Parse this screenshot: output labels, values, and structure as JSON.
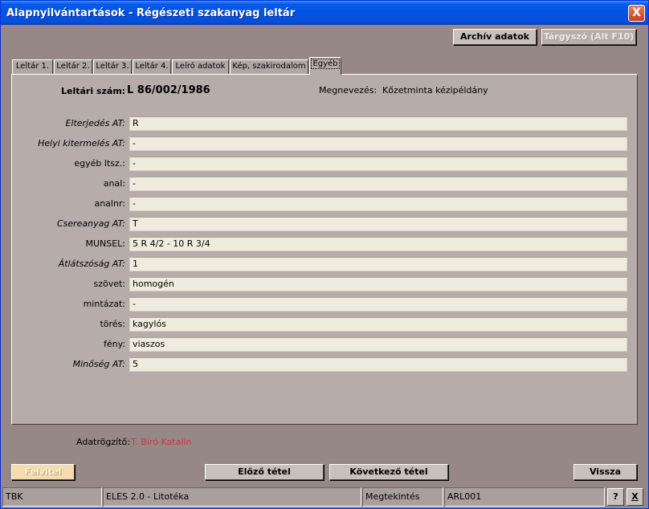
{
  "window": {
    "title": "Alapnyilvántartások - Régészeti szakanyag leltár",
    "close_label": "X"
  },
  "toolbar": {
    "archive_label": "Archív adatok",
    "subject_label": "Tárgyszó (Alt F10)"
  },
  "tabs": [
    {
      "label": "Leltár 1."
    },
    {
      "label": "Leltár 2."
    },
    {
      "label": "Leltár 3."
    },
    {
      "label": "Leltár 4."
    },
    {
      "label": "Leíró adatok"
    },
    {
      "label": "Kép, szakirodalom"
    },
    {
      "label": "Egyéb",
      "active": true
    }
  ],
  "header": {
    "inv_label": "Leltári szám:",
    "inv_value": "L 86/002/1986",
    "name_label": "Megnevezés:",
    "name_value": "Kőzetminta kézipéldány"
  },
  "fields": [
    {
      "label": "Elterjedés AT:",
      "value": "R"
    },
    {
      "label": "Helyi kitermelés AT:",
      "value": "-"
    },
    {
      "label": "egyéb ltsz.:",
      "value": "-"
    },
    {
      "label": "anal:",
      "value": "-"
    },
    {
      "label": "analnr:",
      "value": "-"
    },
    {
      "label": "Csereanyag AT:",
      "value": "T"
    },
    {
      "label": "MUNSEL:",
      "value": "5 R 4/2 - 10 R 3/4"
    },
    {
      "label": "Átlátszóság AT:",
      "value": "1"
    },
    {
      "label": "szövet:",
      "value": "homogén"
    },
    {
      "label": "mintázat:",
      "value": "-"
    },
    {
      "label": "törés:",
      "value": "kagylós"
    },
    {
      "label": "fény:",
      "value": "viaszos"
    },
    {
      "label": "Minőség AT:",
      "value": "5"
    }
  ],
  "recorder": {
    "label": "Adatrögzítő:",
    "value": "T. Bíró Katalin"
  },
  "actions": {
    "new_label": "Felvitel",
    "prev_label": "Előző tétel",
    "next_label": "Következő tétel",
    "back_label": "Vissza"
  },
  "statusbar": {
    "module": "TBK",
    "app": "ELES 2.0 - Litotéka",
    "mode": "Megtekintés",
    "code": "ARL001",
    "help_label": "?",
    "exit_label": "X"
  },
  "colors": {
    "recorder_value": "#c83c3c",
    "titlebar": "#0054e3"
  }
}
